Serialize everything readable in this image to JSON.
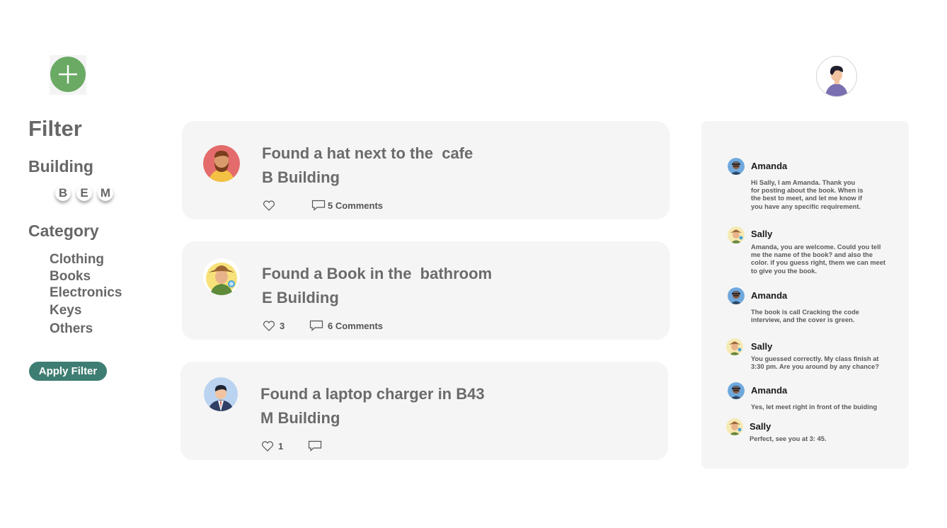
{
  "header": {
    "add_button_icon": "plus-icon",
    "profile_avatar_icon": "user-avatar-icon"
  },
  "filter": {
    "title": "Filter",
    "building_title": "Building",
    "buildings": [
      "B",
      "E",
      "M"
    ],
    "category_title": "Category",
    "categories": [
      "Clothing",
      "Books",
      "Electronics",
      "Keys",
      "Others"
    ],
    "apply_label": "Apply Filter"
  },
  "posts": [
    {
      "title": "Found a hat next to the  cafe",
      "building": "B Building",
      "likes": "",
      "comments": "5 Comments",
      "avatar_icon": "man-beard-avatar-icon"
    },
    {
      "title": "Found a Book in the  bathroom",
      "building": "E Building",
      "likes": "3",
      "comments": "6 Comments",
      "avatar_icon": "woman-hat-avatar-icon"
    },
    {
      "title": "Found a laptop charger in B43",
      "building": "M Building",
      "likes": "1",
      "comments": "",
      "avatar_icon": "man-suit-avatar-icon"
    }
  ],
  "chat": {
    "messages": [
      {
        "name": "Amanda",
        "text": "Hi Sally, I am Amanda. Thank you for posting about the book. When is the best to meet, and let me know if you have any specific requirement."
      },
      {
        "name": "Sally",
        "text": "Amanda, you are welcome. Could you tell me the name of the book? and also the color. if you guess right, them we can meet to give you the book."
      },
      {
        "name": "Amanda",
        "text": "The book is call Cracking the code interview, and the cover is green."
      },
      {
        "name": "Sally",
        "text": "You guessed correctly.  My class finish at 3:30 pm. Are you around by any chance?"
      },
      {
        "name": "Amanda",
        "text": "Yes, let meet right in front of the buiding"
      },
      {
        "name": "Sally",
        "text": "Perfect, see you at 3: 45."
      }
    ]
  },
  "colors": {
    "accent_green": "#6aaa64",
    "apply_button": "#3e7d72",
    "card_bg": "#f5f5f5",
    "text_gray": "#6b6b6b"
  }
}
